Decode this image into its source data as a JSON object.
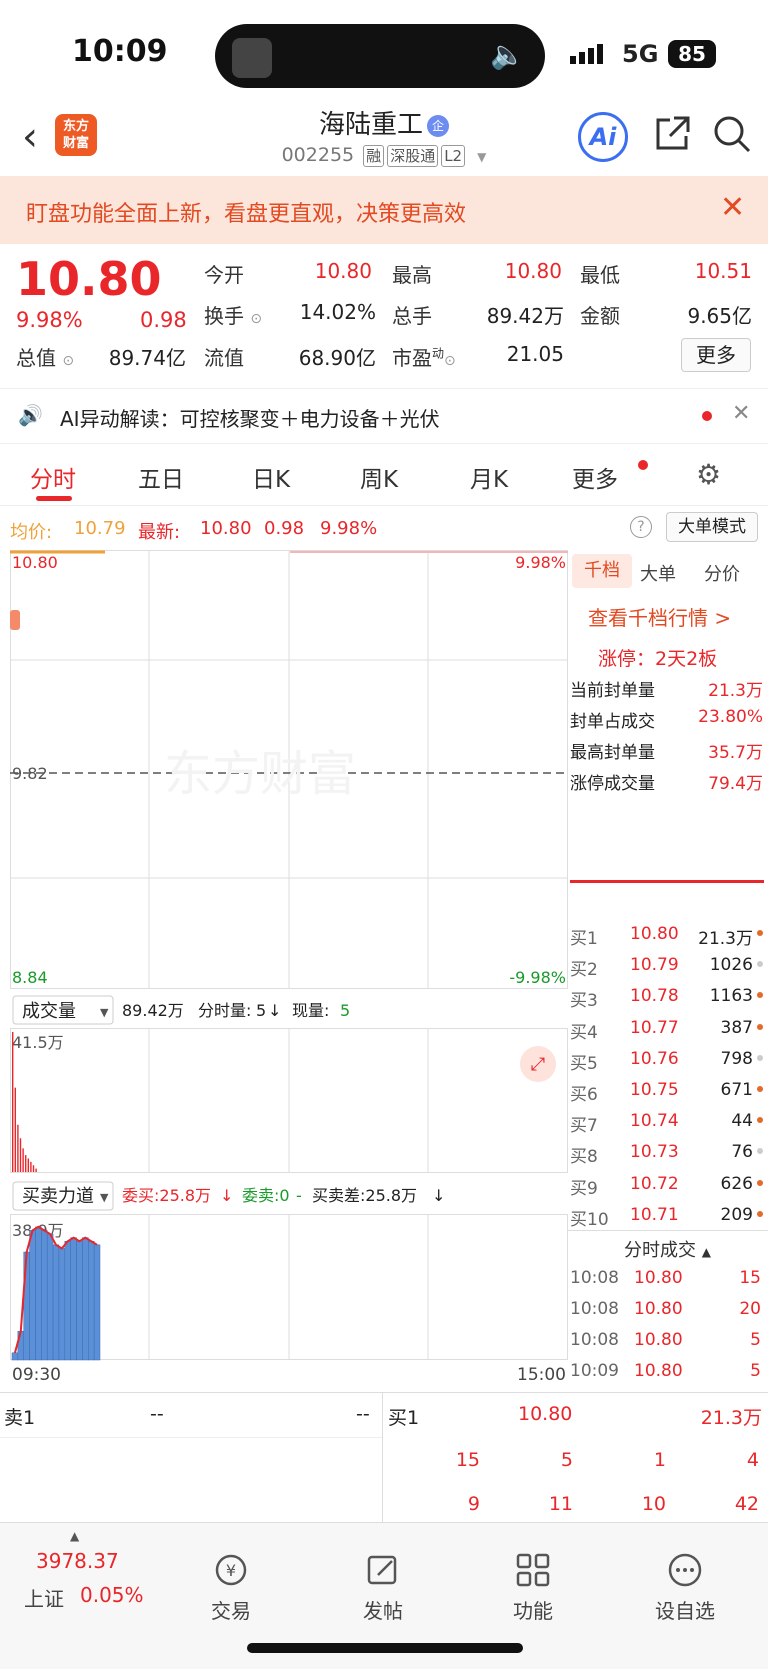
{
  "status": {
    "time": "10:09",
    "network": "5G",
    "battery": "85"
  },
  "header": {
    "logo": "东方\n财富",
    "name": "海陆重工",
    "badge": "企",
    "code": "002255",
    "tags": [
      "融",
      "深股通",
      "L2"
    ],
    "ai_label": "Ai"
  },
  "banner": {
    "text": "盯盘功能全面上新，看盘更直观，决策更高效"
  },
  "quote": {
    "price": "10.80",
    "pct": "9.98%",
    "chg": "0.98",
    "rows": [
      [
        {
          "label": "今开",
          "value": "10.80",
          "color": "red"
        },
        {
          "label": "最高",
          "value": "10.80",
          "color": "red"
        },
        {
          "label": "最低",
          "value": "10.51",
          "color": "red"
        }
      ],
      [
        {
          "label": "换手",
          "value": "14.02%",
          "color": "dark"
        },
        {
          "label": "总手",
          "value": "89.42万",
          "color": "dark"
        },
        {
          "label": "金额",
          "value": "9.65亿",
          "color": "dark"
        }
      ],
      [
        {
          "label": "总值",
          "value": "89.74亿",
          "color": "dark"
        },
        {
          "label": "流值",
          "value": "68.90亿",
          "color": "dark"
        },
        {
          "label": "市盈",
          "sup": "动",
          "value": "21.05",
          "color": "dark"
        }
      ]
    ],
    "more": "更多"
  },
  "ai_line": {
    "text": "AI异动解读：可控核聚变＋电力设备＋光伏"
  },
  "tabs": [
    "分时",
    "五日",
    "日K",
    "周K",
    "月K",
    "更多"
  ],
  "avgline": {
    "avg_label": "均价:",
    "avg_value": "10.79",
    "latest_label": "最新:",
    "latest": "10.80",
    "chg": "0.98",
    "pct": "9.98%",
    "mode_btn": "大单模式"
  },
  "chart": {
    "y_top": "10.80",
    "y_mid": "9.82",
    "y_bot": "8.84",
    "pct_top": "9.98%",
    "pct_bot": "-9.98%",
    "watermark": "东方财富",
    "start_time": "09:30",
    "end_time": "15:00",
    "vol": {
      "selector": "成交量",
      "total": "89.42万",
      "minute_label": "分时量:",
      "minute": "5",
      "current_label": "现量:",
      "current": "5",
      "ymax": "41.5万"
    },
    "force": {
      "selector": "买卖力道",
      "buy": "委买:25.8万",
      "sell": "委卖:0",
      "diff": "买卖差:25.8万",
      "ymax": "38.9万"
    }
  },
  "chart_data": [
    {
      "type": "line",
      "title": "",
      "ylim": [
        8.84,
        10.8
      ],
      "x": [
        "09:30",
        "15:00"
      ],
      "series": [
        {
          "values": [
            10.8,
            10.8
          ]
        }
      ]
    },
    {
      "type": "bar",
      "ylabel": "",
      "ymax": 41.5,
      "values": [
        41.5,
        25,
        14,
        10,
        7,
        5,
        4,
        3,
        2,
        1
      ]
    },
    {
      "type": "area",
      "ymax": 38.9,
      "values": [
        2,
        8,
        30,
        36,
        37,
        36,
        35,
        32,
        31,
        33,
        34,
        33,
        34,
        33,
        32
      ]
    }
  ],
  "panel": {
    "tabs": [
      "千档",
      "大单",
      "分价"
    ],
    "link": "查看千档行情 >",
    "limit": "涨停：2天2板",
    "stats": [
      {
        "label": "当前封单量",
        "value": "21.3万"
      },
      {
        "label": "封单占成交",
        "value": "23.80%"
      },
      {
        "label": "最高封单量",
        "value": "35.7万"
      },
      {
        "label": "涨停成交量",
        "value": "79.4万"
      }
    ],
    "bids": [
      {
        "name": "买1",
        "price": "10.80",
        "vol": "21.3万"
      },
      {
        "name": "买2",
        "price": "10.79",
        "vol": "1026"
      },
      {
        "name": "买3",
        "price": "10.78",
        "vol": "1163"
      },
      {
        "name": "买4",
        "price": "10.77",
        "vol": "387"
      },
      {
        "name": "买5",
        "price": "10.76",
        "vol": "798"
      },
      {
        "name": "买6",
        "price": "10.75",
        "vol": "671"
      },
      {
        "name": "买7",
        "price": "10.74",
        "vol": "44"
      },
      {
        "name": "买8",
        "price": "10.73",
        "vol": "76"
      },
      {
        "name": "买9",
        "price": "10.72",
        "vol": "626"
      },
      {
        "name": "买10",
        "price": "10.71",
        "vol": "209"
      }
    ],
    "trades_title": "分时成交",
    "trades": [
      {
        "time": "10:08",
        "price": "10.80",
        "vol": "15"
      },
      {
        "time": "10:08",
        "price": "10.80",
        "vol": "20"
      },
      {
        "time": "10:08",
        "price": "10.80",
        "vol": "5"
      },
      {
        "time": "10:09",
        "price": "10.80",
        "vol": "5"
      }
    ]
  },
  "bottom": {
    "sell_label": "卖1",
    "sell_p": "--",
    "sell_v": "--",
    "buy_label": "买1",
    "buy_p": "10.80",
    "buy_v": "21.3万",
    "row1": [
      "15",
      "5",
      "1",
      "4"
    ],
    "row2": [
      "9",
      "11",
      "10",
      "42"
    ]
  },
  "tabbar": {
    "index_value": "3978.37",
    "index_name": "上证",
    "index_pct": "0.05%",
    "items": [
      "交易",
      "发帖",
      "功能",
      "设自选"
    ]
  }
}
